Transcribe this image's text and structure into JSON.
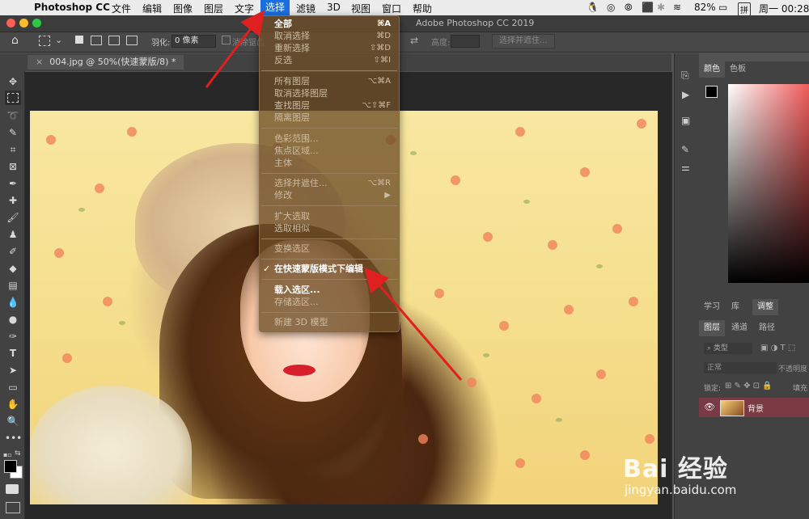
{
  "menubar": {
    "app_name": "Photoshop CC",
    "items": [
      "文件",
      "编辑",
      "图像",
      "图层",
      "文字",
      "选择",
      "滤镜",
      "3D",
      "视图",
      "窗口",
      "帮助"
    ],
    "selected": "选择",
    "battery": "82%",
    "input_method": "拼",
    "clock": "周一 00:28"
  },
  "window_title": "Adobe Photoshop CC 2019",
  "options": {
    "feather_label": "羽化:",
    "feather_value": "0 像素",
    "antialias_label": "消除锯齿",
    "height_label": "高度:",
    "select_mask_button": "选择并遮住..."
  },
  "document_tab": "004.jpg @ 50%(快速蒙版/8) *",
  "select_menu": {
    "all": {
      "label": "全部",
      "shortcut": "⌘A"
    },
    "deselect": {
      "label": "取消选择",
      "shortcut": "⌘D"
    },
    "reselect": {
      "label": "重新选择",
      "shortcut": "⇧⌘D"
    },
    "inverse": {
      "label": "反选",
      "shortcut": "⇧⌘I"
    },
    "all_layers": {
      "label": "所有图层",
      "shortcut": "⌥⌘A"
    },
    "deselect_layers": {
      "label": "取消选择图层",
      "shortcut": ""
    },
    "find_layers": {
      "label": "查找图层",
      "shortcut": "⌥⇧⌘F"
    },
    "isolate_layers": {
      "label": "隔离图层",
      "shortcut": ""
    },
    "color_range": {
      "label": "色彩范围...",
      "shortcut": ""
    },
    "focus_area": {
      "label": "焦点区域...",
      "shortcut": ""
    },
    "subject": {
      "label": "主体",
      "shortcut": ""
    },
    "select_and_mask": {
      "label": "选择并遮住...",
      "shortcut": "⌥⌘R"
    },
    "modify": {
      "label": "修改",
      "shortcut": "▶"
    },
    "grow": {
      "label": "扩大选取",
      "shortcut": ""
    },
    "similar": {
      "label": "选取相似",
      "shortcut": ""
    },
    "transform_selection": {
      "label": "变换选区",
      "shortcut": ""
    },
    "quick_mask": {
      "label": "在快速蒙版模式下编辑",
      "check": "✓"
    },
    "load_selection": {
      "label": "载入选区...",
      "shortcut": ""
    },
    "save_selection": {
      "label": "存储选区...",
      "shortcut": ""
    },
    "new_3d": {
      "label": "新建 3D 模型",
      "shortcut": ""
    }
  },
  "right_panel": {
    "color_tab": "颜色",
    "swatches_tab": "色板",
    "learn_tab": "学习",
    "library_tab": "库",
    "adjust_tab": "调整",
    "layers_tab": "图层",
    "channels_tab": "通道",
    "paths_tab": "路径",
    "kind_filter": "类型",
    "blend_mode": "正常",
    "opacity_label": "不透明度",
    "lock_label": "锁定:",
    "fill_label": "填充",
    "layer_name": "背景"
  },
  "watermark": {
    "logo": "Bai 经验",
    "url": "jingyan.baidu.com"
  },
  "colors": {
    "menu_highlight": "#1a6fe0",
    "arrow": "#e02020",
    "layer_selected": "#7a3a43"
  }
}
